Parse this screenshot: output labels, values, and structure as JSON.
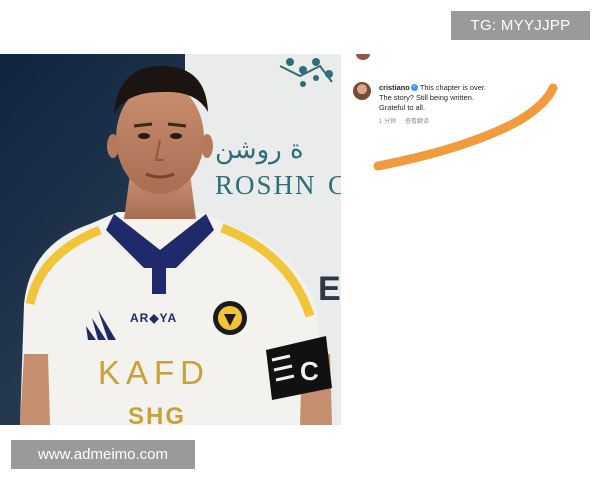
{
  "watermarks": {
    "top": "TG: MYYJJPP",
    "bottom": "www.admeimo.com"
  },
  "photo": {
    "backdrop_arabic": "ة روشن",
    "backdrop_latin": "ROSHN",
    "backdrop_edge_letter_top": "C",
    "backdrop_edge_letter_mid": "E",
    "jersey": {
      "sponsor_top": "AR◆YA",
      "sponsor_main": "KAFD",
      "sponsor_bottom": "SHG",
      "armband": "C"
    },
    "colors": {
      "jersey": "#f3f2ee",
      "jersey_trim": "#f0c53a",
      "collar": "#1f2a6b",
      "armband": "#111111"
    }
  },
  "comment": {
    "username": "cristiano",
    "verified_icon": "verified-badge-icon",
    "text_line1": "This chapter is over.",
    "text_line2": "The story? Still being written.",
    "text_line3": "Grateful to all.",
    "time": "1 分钟",
    "translate": "查看翻译"
  },
  "annotation": {
    "stroke_color": "#f19a3e"
  }
}
